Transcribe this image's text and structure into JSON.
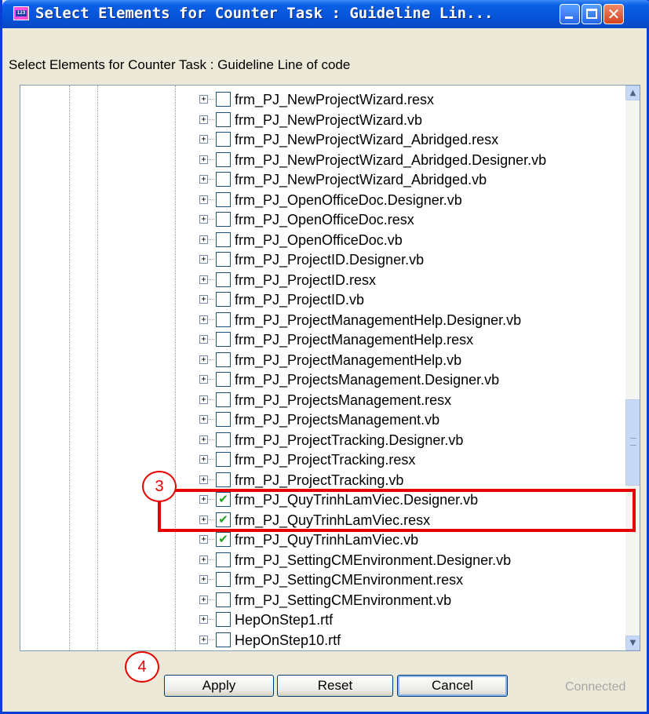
{
  "window": {
    "title": "Select Elements for Counter Task : Guideline Lin...",
    "subtitle": "Select Elements for Counter Task : Guideline Line of code",
    "app_icon": "123-icon",
    "controls": {
      "minimize": "minimize-icon",
      "maximize": "maximize-icon",
      "close": "✕"
    }
  },
  "tree": {
    "expander_glyph": "+",
    "check_glyph": "✔",
    "items": [
      {
        "label": "frm_PJ_NewProjectWizard.resx",
        "checked": false
      },
      {
        "label": "frm_PJ_NewProjectWizard.vb",
        "checked": false
      },
      {
        "label": "frm_PJ_NewProjectWizard_Abridged.resx",
        "checked": false
      },
      {
        "label": "frm_PJ_NewProjectWizard_Abridged.Designer.vb",
        "checked": false
      },
      {
        "label": "frm_PJ_NewProjectWizard_Abridged.vb",
        "checked": false
      },
      {
        "label": "frm_PJ_OpenOfficeDoc.Designer.vb",
        "checked": false
      },
      {
        "label": "frm_PJ_OpenOfficeDoc.resx",
        "checked": false
      },
      {
        "label": "frm_PJ_OpenOfficeDoc.vb",
        "checked": false
      },
      {
        "label": "frm_PJ_ProjectID.Designer.vb",
        "checked": false
      },
      {
        "label": "frm_PJ_ProjectID.resx",
        "checked": false
      },
      {
        "label": "frm_PJ_ProjectID.vb",
        "checked": false
      },
      {
        "label": "frm_PJ_ProjectManagementHelp.Designer.vb",
        "checked": false
      },
      {
        "label": "frm_PJ_ProjectManagementHelp.resx",
        "checked": false
      },
      {
        "label": "frm_PJ_ProjectManagementHelp.vb",
        "checked": false
      },
      {
        "label": "frm_PJ_ProjectsManagement.Designer.vb",
        "checked": false
      },
      {
        "label": "frm_PJ_ProjectsManagement.resx",
        "checked": false
      },
      {
        "label": "frm_PJ_ProjectsManagement.vb",
        "checked": false
      },
      {
        "label": "frm_PJ_ProjectTracking.Designer.vb",
        "checked": false
      },
      {
        "label": "frm_PJ_ProjectTracking.resx",
        "checked": false
      },
      {
        "label": "frm_PJ_ProjectTracking.vb",
        "checked": false
      },
      {
        "label": "frm_PJ_QuyTrinhLamViec.Designer.vb",
        "checked": true
      },
      {
        "label": "frm_PJ_QuyTrinhLamViec.resx",
        "checked": true
      },
      {
        "label": "frm_PJ_QuyTrinhLamViec.vb",
        "checked": true
      },
      {
        "label": "frm_PJ_SettingCMEnvironment.Designer.vb",
        "checked": false
      },
      {
        "label": "frm_PJ_SettingCMEnvironment.resx",
        "checked": false
      },
      {
        "label": "frm_PJ_SettingCMEnvironment.vb",
        "checked": false
      },
      {
        "label": "HepOnStep1.rtf",
        "checked": false
      },
      {
        "label": "HepOnStep10.rtf",
        "checked": false
      },
      {
        "label": "",
        "checked": false
      }
    ]
  },
  "scrollbar": {
    "up": "▲",
    "down": "▼",
    "position": 0.6
  },
  "annotations": {
    "callout_3": "3",
    "callout_4": "4"
  },
  "buttons": {
    "apply": "Apply",
    "reset": "Reset",
    "cancel": "Cancel"
  },
  "status": "Connected",
  "colors": {
    "title_blue": "#0654d9",
    "check_green": "#21a121",
    "annotation_red": "#e60000"
  }
}
